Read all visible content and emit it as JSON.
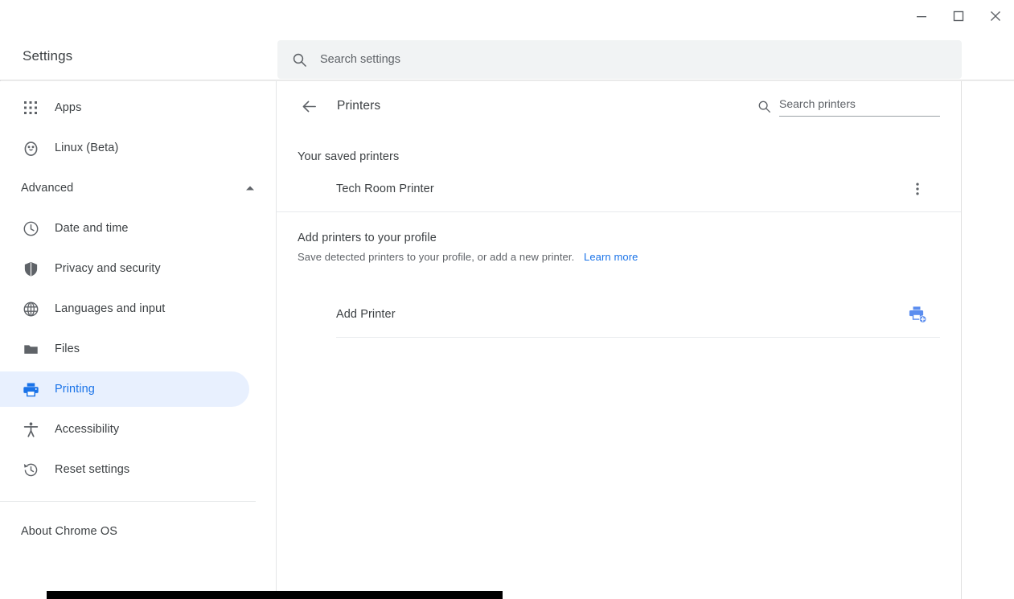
{
  "window": {
    "controls": [
      {
        "name": "minimize",
        "label": "Minimize"
      },
      {
        "name": "maximize",
        "label": "Maximize"
      },
      {
        "name": "close",
        "label": "Close"
      }
    ]
  },
  "header": {
    "app_title": "Settings",
    "search": {
      "icon": "search-icon",
      "placeholder": "Search settings",
      "value": ""
    }
  },
  "sidebar": {
    "items": [
      {
        "label": "Apps",
        "icon": "apps-grid-icon",
        "selected": false
      },
      {
        "label": "Linux (Beta)",
        "icon": "linux-penguin-icon",
        "selected": false
      }
    ],
    "advanced": {
      "label": "Advanced",
      "expanded": true,
      "chevron_icon": "chevron-up-icon",
      "items": [
        {
          "label": "Date and time",
          "icon": "clock-icon",
          "selected": false
        },
        {
          "label": "Privacy and security",
          "icon": "shield-icon",
          "selected": false
        },
        {
          "label": "Languages and input",
          "icon": "globe-icon",
          "selected": false
        },
        {
          "label": "Files",
          "icon": "folder-icon",
          "selected": false
        },
        {
          "label": "Printing",
          "icon": "printer-icon",
          "selected": true
        },
        {
          "label": "Accessibility",
          "icon": "accessibility-person-icon",
          "selected": false
        },
        {
          "label": "Reset settings",
          "icon": "restore-history-icon",
          "selected": false
        }
      ]
    },
    "about": {
      "label": "About Chrome OS"
    }
  },
  "main": {
    "back_icon": "back-arrow-icon",
    "page_title": "Printers",
    "printer_search": {
      "icon": "search-icon",
      "placeholder": "Search printers",
      "value": ""
    },
    "saved_section": {
      "label": "Your saved printers",
      "printers": [
        {
          "name": "Tech Room Printer",
          "menu_icon": "more-vert-icon"
        }
      ]
    },
    "add_section": {
      "title": "Add printers to your profile",
      "subtitle": "Save detected printers to your profile, or add a new printer.",
      "link_label": "Learn more",
      "add_row": {
        "label": "Add Printer",
        "icon": "add-printer-icon"
      }
    }
  },
  "colors": {
    "accent": "#1a73e8",
    "selected_bg": "#e8f0fe",
    "text_primary": "#3c4043",
    "text_secondary": "#5f6368",
    "search_bg": "#f1f3f4",
    "divider": "#e8eaed"
  }
}
